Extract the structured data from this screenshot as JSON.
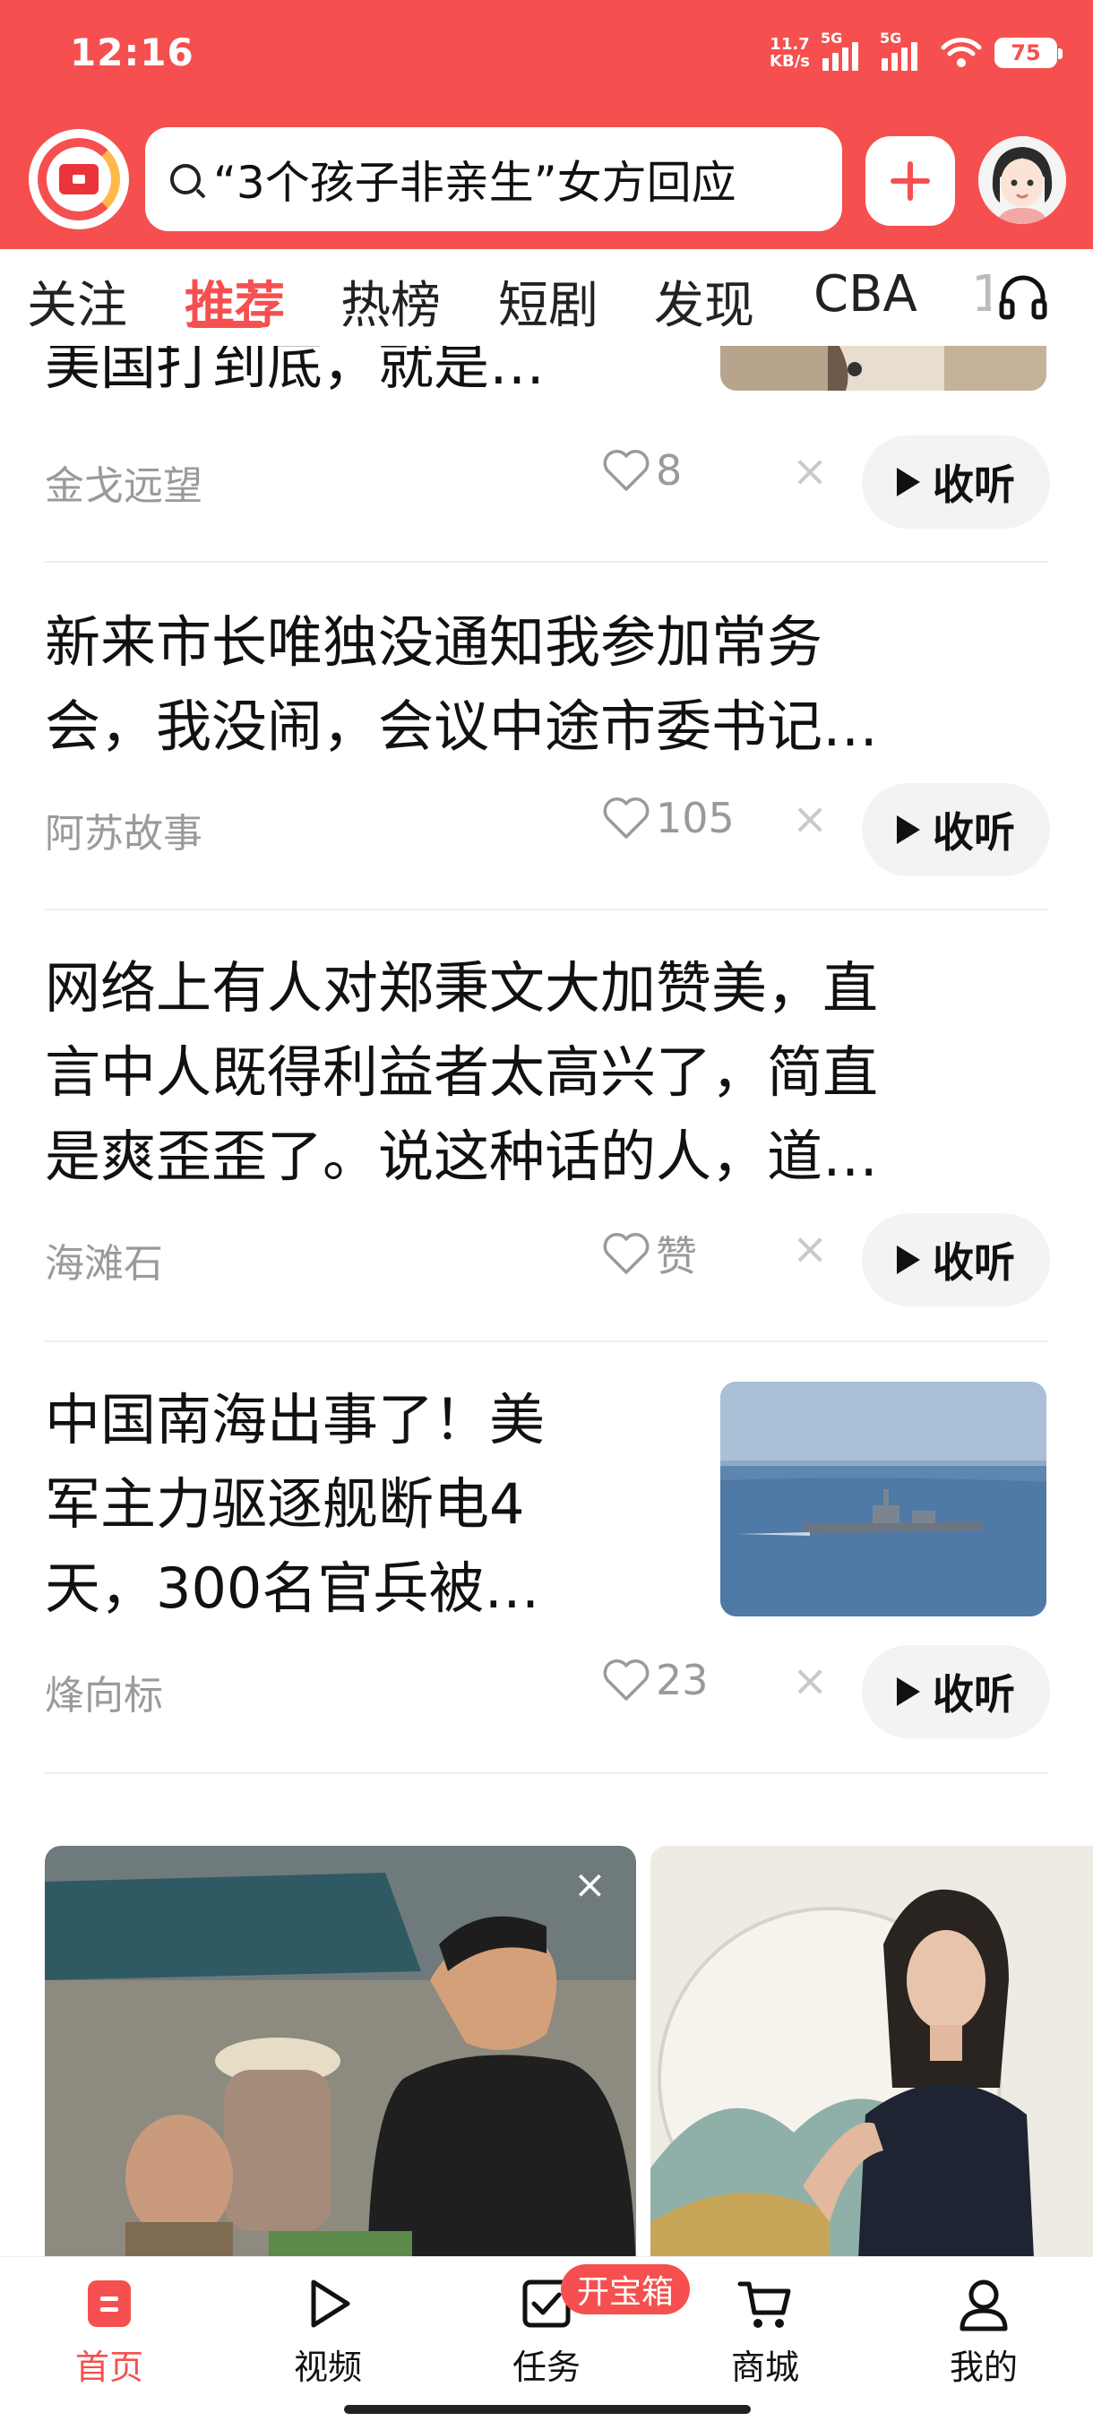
{
  "status_bar": {
    "time": "12:16",
    "net_speed_value": "11.7",
    "net_speed_unit": "KB/s",
    "signal_1": "5G",
    "signal_2": "5G",
    "battery": "75"
  },
  "header": {
    "search_text": "“3个孩子非亲生”女方回应"
  },
  "tabs": [
    "关注",
    "推荐",
    "热榜",
    "短剧",
    "发现",
    "CBA",
    "1"
  ],
  "active_tab": "推荐",
  "feed": {
    "articles": [
      {
        "title_lines": [
          "美国打到底，就是…"
        ],
        "source": "金戈远望",
        "likes": "8",
        "listen_label": "收听"
      },
      {
        "title_lines": [
          "新来市长唯独没通知我参加常务",
          "会，我没闹，会议中途市委书记…"
        ],
        "source": "阿苏故事",
        "likes": "105",
        "listen_label": "收听"
      },
      {
        "title_lines": [
          "网络上有人对郑秉文大加赞美，直",
          "言中人既得利益者太高兴了，简直",
          "是爽歪歪了。说这种话的人，道…"
        ],
        "source": "海滩石",
        "likes": "赞",
        "listen_label": "收听"
      },
      {
        "title_lines": [
          "中国南海出事了！美",
          "军主力驱逐舰断电4",
          "天，300名官兵被…"
        ],
        "source": "烽向标",
        "likes": "23",
        "listen_label": "收听"
      }
    ],
    "dismiss_glyph": "×"
  },
  "bottom_nav": {
    "items": [
      "首页",
      "视频",
      "任务",
      "商城",
      "我的"
    ],
    "active": "首页",
    "task_badge": "开宝箱"
  },
  "colors": {
    "brand_red": "#f5504f",
    "muted_text": "#9a9a9a"
  }
}
